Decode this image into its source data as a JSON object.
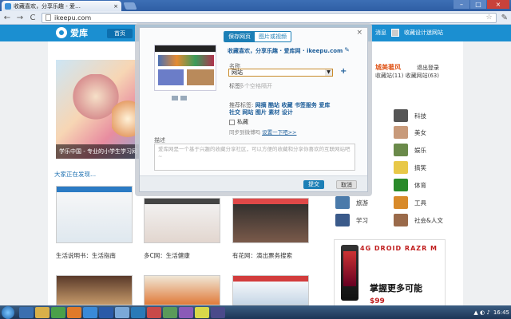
{
  "browser": {
    "tab_title": "收藏喜欢，分享乐趣 - 爱…",
    "close_tab": "×",
    "url": "ikeepu.com",
    "back": "←",
    "forward": "→",
    "reload": "C",
    "star": "☆",
    "menu": "✎",
    "win_min": "–",
    "win_max": "□",
    "win_close": "×"
  },
  "site": {
    "logo_text": "爱库",
    "home_label": "首页",
    "messages_label": "消息",
    "user_name": "收藏设计迷网站"
  },
  "featured": {
    "caption": "学乐中国 - 专业的小学生学习网"
  },
  "discover_label": "大家正在发现...",
  "thumbs": [
    {
      "caption": "生活说明书：生活指南"
    },
    {
      "caption": "多C网：生活健康"
    },
    {
      "caption": "有花网：演出票务搜索"
    }
  ],
  "sidebar": {
    "title": "城美著风",
    "logout": "退出登录",
    "stats": "收藏站(11) 收藏网站(63)"
  },
  "categories": [
    {
      "label": "科技"
    },
    {
      "label": "美女"
    },
    {
      "label": "娱乐"
    },
    {
      "label": "搞笑"
    },
    {
      "label": "体育"
    },
    {
      "label": "旅游"
    },
    {
      "label": "工具"
    },
    {
      "label": "学习"
    },
    {
      "label": "社会&人文"
    }
  ],
  "ad": {
    "brand": "4G DROID RAZR M",
    "slogan": "掌握更多可能",
    "price": "$99"
  },
  "modal": {
    "tab_web": "保存网页",
    "tab_image": "图片或视频",
    "close": "×",
    "site_title": "收藏喜欢，分享乐趣 · 爱库网 · ikeepu.com",
    "label_name": "名称",
    "select_value": "网站",
    "add": "+",
    "label_tags": "标签",
    "tags_placeholder": "多个空格隔开",
    "rec_tags_label": "推荐标签:",
    "rec_tags": "网摘 酷站 收藏 书签服务 爱库 社交 网站 图片 素材 设计",
    "private_label": "私藏",
    "sync_text": "同步到微博吗",
    "sync_link": "设置一下吧>>",
    "desc_label": "描述",
    "desc_placeholder": "爱库网是一个基于兴趣的收藏分享社区，可以方便的收藏和分享你喜欢的互联网站吧~",
    "submit": "提交",
    "cancel": "取消"
  },
  "taskbar": {
    "time": "16:45"
  }
}
